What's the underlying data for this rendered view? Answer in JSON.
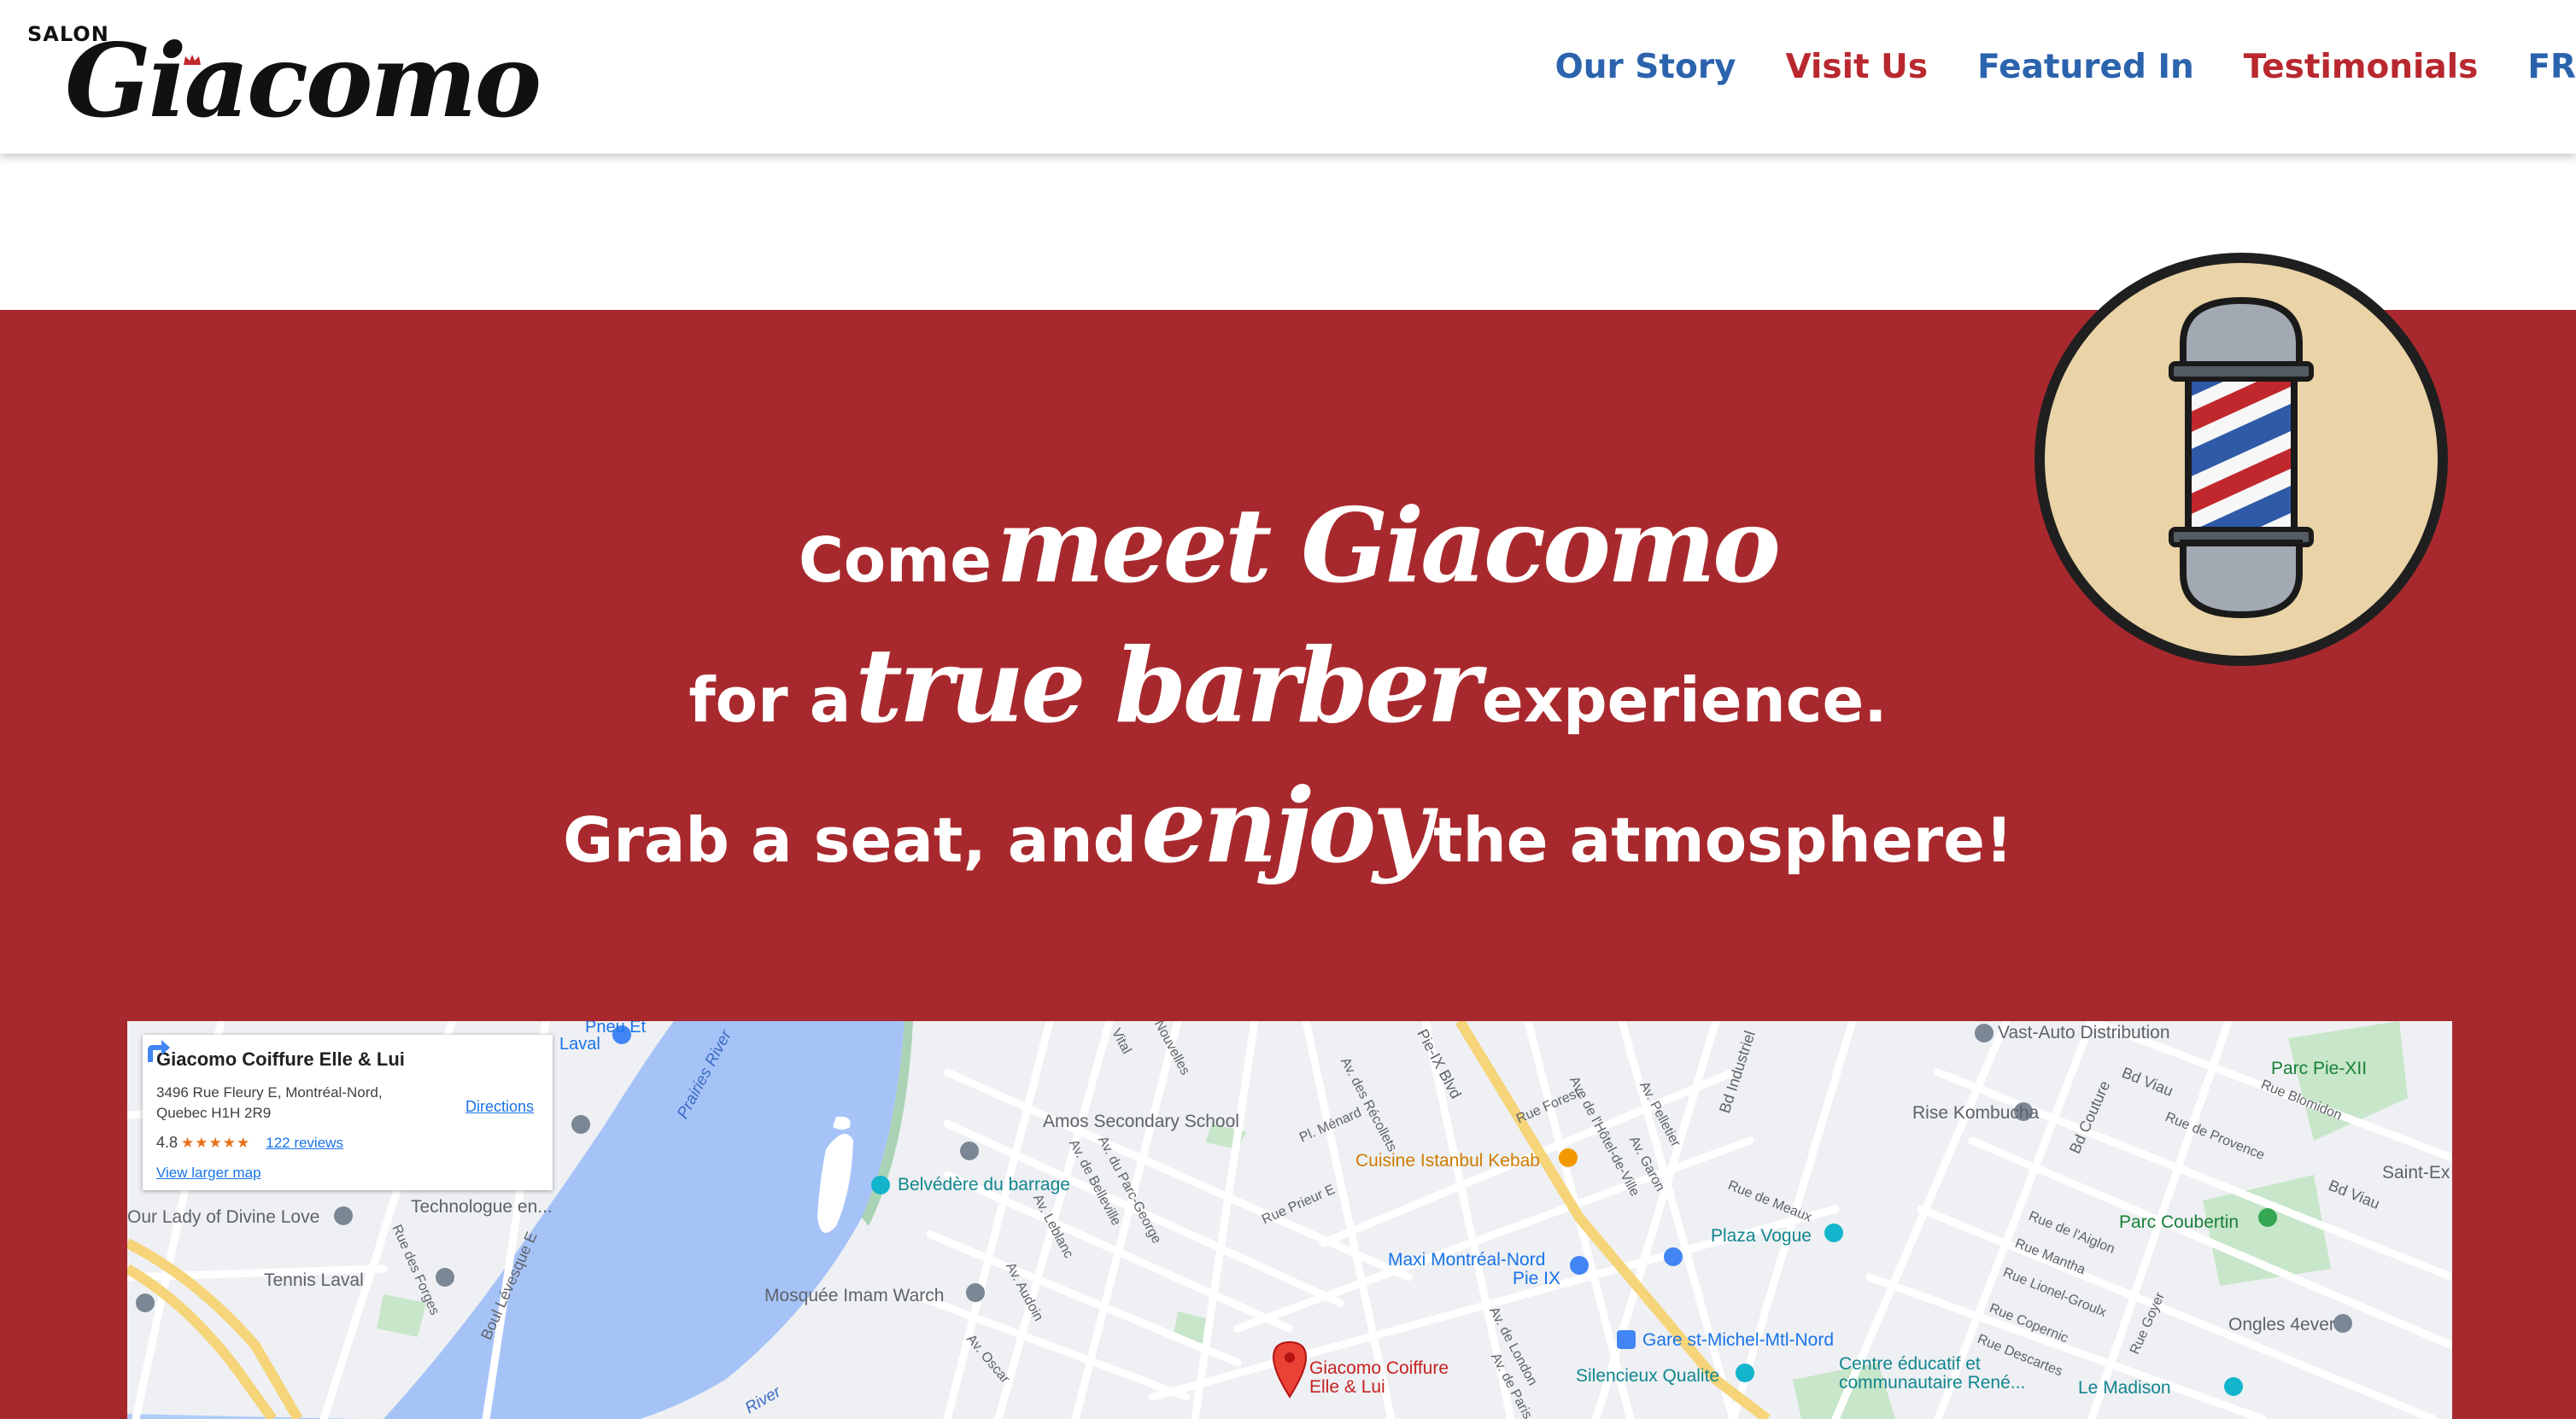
{
  "header": {
    "logo_salon": "SALON",
    "logo_name": "Giacomo",
    "nav": [
      {
        "label": "Our Story",
        "color": "#2b63ad"
      },
      {
        "label": "Visit Us",
        "color": "#b8282e"
      },
      {
        "label": "Featured In",
        "color": "#2b63ad"
      },
      {
        "label": "Testimonials",
        "color": "#b8282e"
      },
      {
        "label": "FR",
        "color": "#2b63ad"
      }
    ]
  },
  "hero": {
    "background": "#a8292d",
    "line1": {
      "plain": "Come",
      "script": "meet Giacomo"
    },
    "line2": {
      "plain_before": "for a",
      "script": "true barber",
      "plain_after": "experience."
    },
    "line3": {
      "plain_before": "Grab a seat, and",
      "script": "enjoy",
      "plain_after": "the atmosphere!"
    },
    "badge_icon": "barber-pole-icon"
  },
  "map": {
    "info_card": {
      "name": "Giacomo Coiffure Elle & Lui",
      "address": "3496 Rue Fleury E, Montréal-Nord, Quebec H1H 2R9",
      "rating": "4.8",
      "stars": "★★★★★",
      "reviews": "122 reviews",
      "view_larger": "View larger map",
      "directions": "Directions"
    },
    "pin_label_line1": "Giacomo Coiffure",
    "pin_label_line2": "Elle & Lui",
    "places": {
      "pneu": "Pneu Et",
      "laval": "Laval",
      "technologue": "Technologue en...",
      "our_lady": "Our Lady of Divine Love",
      "tennis": "Tennis Laval",
      "amos": "Amos Secondary School",
      "belvedere": "Belvédère du barrage",
      "mosquee": "Mosquée Imam Warch",
      "cuisine": "Cuisine Istanbul Kebab",
      "maxi1": "Maxi Montréal-Nord",
      "maxi2": "Pie IX",
      "gare": "Gare st-Michel-Mtl-Nord",
      "plaza": "Plaza Vogue",
      "silencieux": "Silencieux Qualite",
      "vast": "Vast-Auto Distribution",
      "rise": "Rise Kombucha",
      "parc_pie": "Parc Pie-XII",
      "coubertin": "Parc Coubertin",
      "ongles": "Ongles 4ever",
      "centre1": "Centre éducatif et",
      "centre2": "communautaire René...",
      "madison": "Le Madison",
      "saintex": "Saint-Ex",
      "prairies": "Prairies River",
      "river": "River"
    },
    "streets": {
      "pie_ix": "Pie-IX Blvd",
      "bd_industriel": "Bd Industriel",
      "bd_viau": "Bd Viau",
      "bd_viau2": "Bd Viau",
      "bd_couture": "Bd Couture",
      "boul_levesque": "Boul Lévesque E",
      "rue_forges": "Rue des Forges",
      "av_recollets": "Av. des Récollets",
      "av_parc_george": "Av. du Parc-George",
      "av_belleville": "Av. de Belleville",
      "av_leblanc": "Av. Leblanc",
      "av_audoin": "Av. Audoin",
      "av_oscar": "Av. Oscar",
      "rue_prieur": "Rue Prieur E",
      "rue_forest": "Rue Forest",
      "av_hotel_ville": "Ave de l'Hôtel-de-Ville",
      "av_pelletier": "Av. Pelletier",
      "av_garon": "Av. Garon",
      "rue_meaux": "Rue de Meaux",
      "rue_provence": "Rue de Provence",
      "rue_blomidon": "Rue Blomidon",
      "rue_aiglon": "Rue de l'Aiglon",
      "rue_mantha": "Rue Mantha",
      "rue_lionel": "Rue Lionel-Groulx",
      "rue_copernic": "Rue Copernic",
      "rue_descartes": "Rue Descartes",
      "rue_goyer": "Rue Goyer",
      "av_london": "Av. de London",
      "av_paris": "Av. de Paris",
      "pl_menard": "Pl. Ménard",
      "vital": "Vital",
      "nouvelles": "Nouvelles"
    }
  }
}
